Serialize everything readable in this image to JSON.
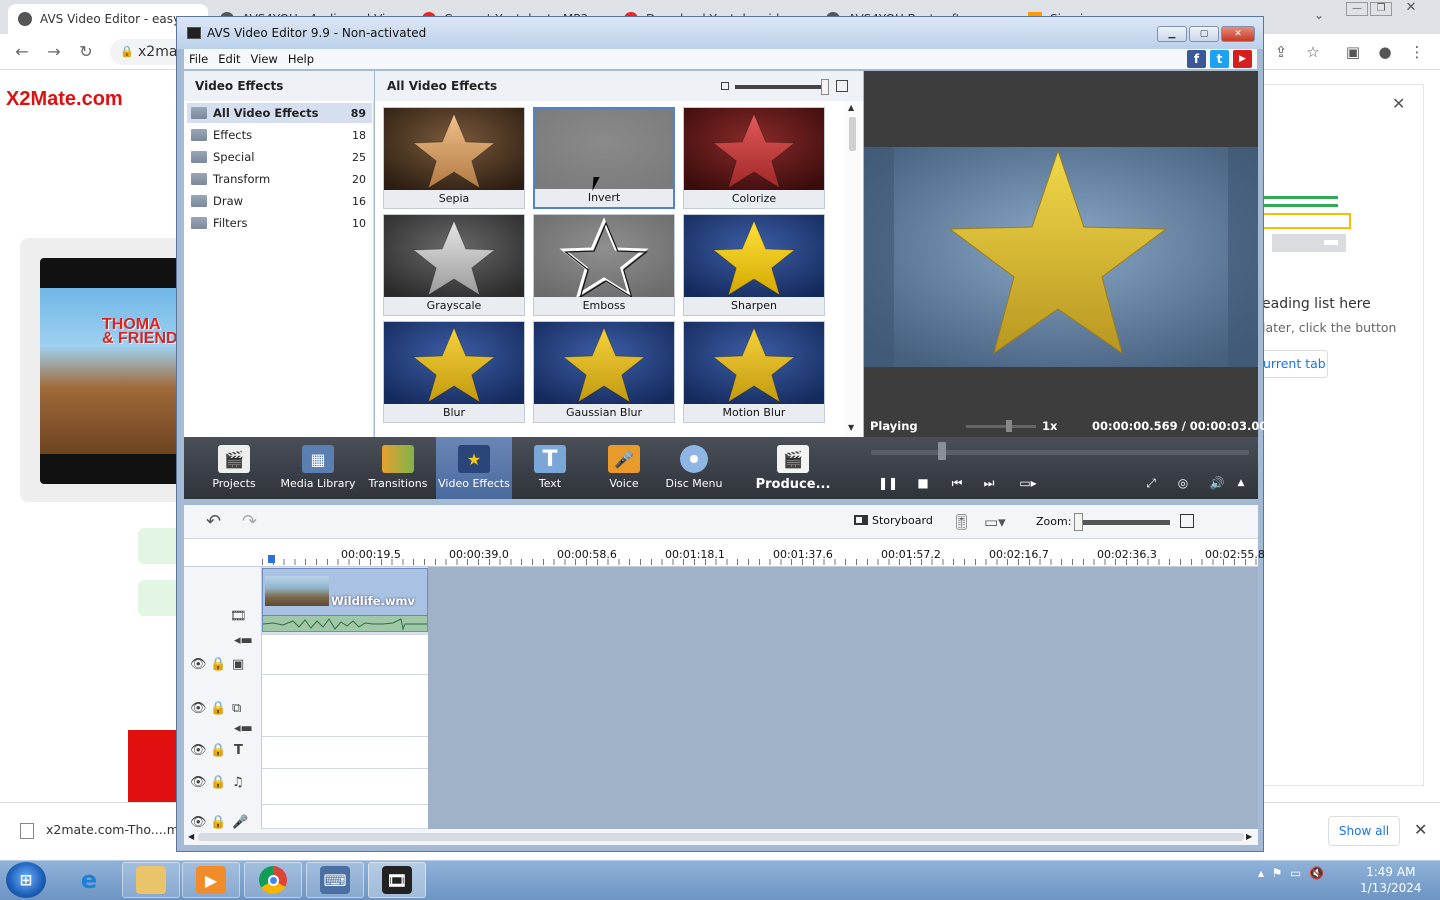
{
  "browser": {
    "tabs": [
      {
        "label": "AVS Video Editor - easy v"
      },
      {
        "label": "AVS4YOU - Audio and Vi"
      },
      {
        "label": "Convert Youtube to MP3"
      },
      {
        "label": "Download Youtube vide"
      },
      {
        "label": "AVS4YOU Best soft..."
      },
      {
        "label": "Sign in"
      }
    ],
    "address": "x2ma",
    "site_logo": "X2Mate.com",
    "thumb_logo": "THOMA\n& FRIEND",
    "side_panel": {
      "title": "eading list here",
      "subtitle": "later, click the button",
      "button": "urrent tab"
    },
    "download": {
      "file": "x2mate.com-Tho....mp",
      "show_all": "Show all"
    }
  },
  "app": {
    "title": "AVS Video Editor 9.9 - Non-activated",
    "menu": [
      "File",
      "Edit",
      "View",
      "Help"
    ],
    "social": [
      {
        "icon": "facebook-icon",
        "glyph": "f",
        "color": "#3b5998"
      },
      {
        "icon": "twitter-icon",
        "glyph": "t",
        "color": "#1da1f2"
      },
      {
        "icon": "youtube-icon",
        "glyph": "▶",
        "color": "#d62020"
      }
    ],
    "effects_panel": {
      "title": "Video Effects",
      "categories": [
        {
          "name": "All Video Effects",
          "count": "89"
        },
        {
          "name": "Effects",
          "count": "18"
        },
        {
          "name": "Special",
          "count": "25"
        },
        {
          "name": "Transform",
          "count": "20"
        },
        {
          "name": "Draw",
          "count": "16"
        },
        {
          "name": "Filters",
          "count": "10"
        }
      ]
    },
    "effects_grid": {
      "title": "All Video Effects",
      "tiles": [
        {
          "label": "Sepia"
        },
        {
          "label": "Invert"
        },
        {
          "label": "Colorize"
        },
        {
          "label": "Grayscale"
        },
        {
          "label": "Emboss"
        },
        {
          "label": "Sharpen"
        },
        {
          "label": "Blur"
        },
        {
          "label": "Gaussian Blur"
        },
        {
          "label": "Motion Blur"
        }
      ]
    },
    "preview": {
      "status": "Playing",
      "speed": "1x",
      "time": "00:00:00.569  /  00:00:03.000"
    },
    "toolbar": [
      {
        "label": "Projects",
        "icon": "projects-icon"
      },
      {
        "label": "Media Library",
        "icon": "media-library-icon"
      },
      {
        "label": "Transitions",
        "icon": "transitions-icon"
      },
      {
        "label": "Video Effects",
        "icon": "video-effects-icon"
      },
      {
        "label": "Text",
        "icon": "text-icon"
      },
      {
        "label": "Voice",
        "icon": "voice-icon"
      },
      {
        "label": "Disc Menu",
        "icon": "disc-menu-icon"
      },
      {
        "label": "Produce...",
        "icon": "produce-icon"
      }
    ],
    "timeline": {
      "storyboard": "Storyboard",
      "zoom": "Zoom:",
      "ruler": [
        "00:00:19.5",
        "00:00:39.0",
        "00:00:58.6",
        "00:01:18.1",
        "00:01:37.6",
        "00:01:57.2",
        "00:02:16.7",
        "00:02:36.3",
        "00:02:55.8"
      ],
      "clip_name": "Wildlife.wmv"
    }
  },
  "taskbar": {
    "time": "1:49 AM",
    "date": "1/13/2024"
  }
}
